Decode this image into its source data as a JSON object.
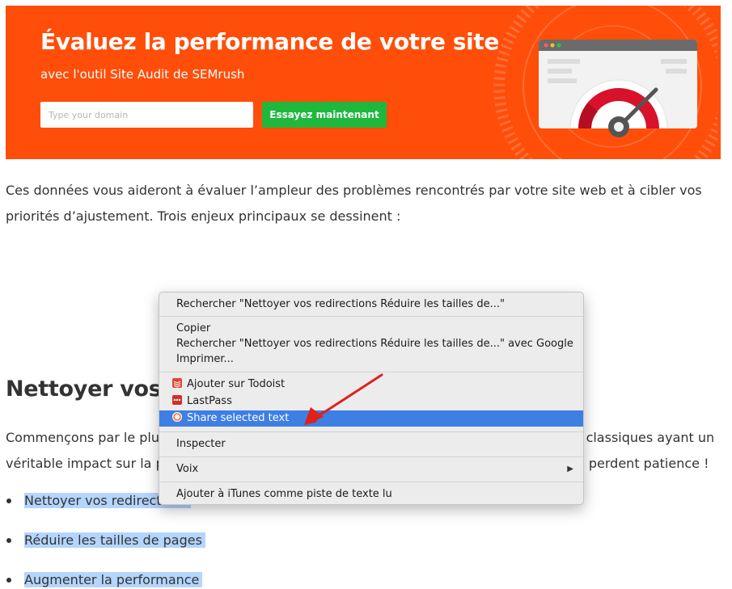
{
  "banner": {
    "title": "Évaluez la performance de votre site",
    "subtitle": "avec l'outil Site Audit de SEMrush",
    "domain_placeholder": "Type your domain",
    "cta_label": "Essayez maintenant",
    "colors": {
      "background": "#ff4e0a",
      "cta": "#1fb83c"
    }
  },
  "article": {
    "paragraph_1": "Ces données vous aideront à évaluer l’ampleur des problèmes rencontrés par votre site web et à cibler vos priorités d’ajustement. Trois enjeux principaux se dessinent :",
    "bullets": [
      "Nettoyer vos redirections",
      "Réduire les tailles de pages",
      "Augmenter la performance"
    ],
    "section_heading": "Nettoyer vos redirections",
    "paragraph_2": "Commençons par le plus important, la vérification des redirections est un des problèmes classiques ayant un véritable impact sur la performance de votre site, voire sur l’usure pour que vos visiteurs perdent patience !"
  },
  "context_menu": {
    "search": "Rechercher \"Nettoyer vos redirections  Réduire les tailles de...\"",
    "copy": "Copier",
    "search_google": "Rechercher \"Nettoyer vos redirections  Réduire les tailles de...\" avec Google",
    "print": "Imprimer...",
    "todoist": "Ajouter sur Todoist",
    "lastpass": "LastPass",
    "share": "Share selected text",
    "inspect": "Inspecter",
    "voice": "Voix",
    "itunes": "Ajouter à iTunes comme piste de texte lu",
    "highlight_color": "#3d7fe3"
  }
}
